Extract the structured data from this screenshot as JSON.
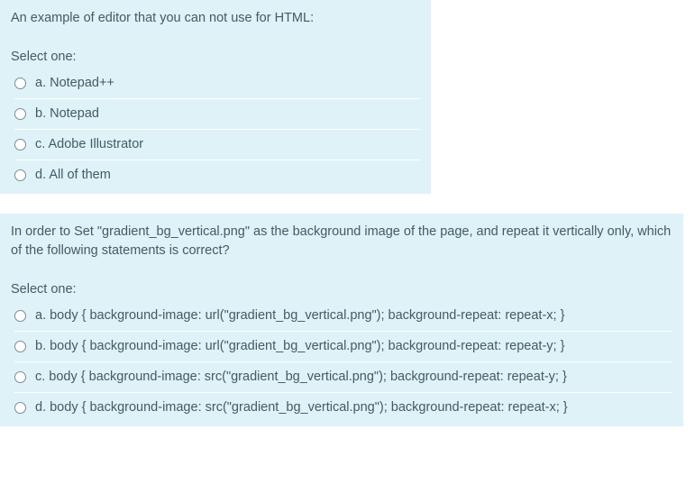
{
  "q1": {
    "text": "An example of editor that you can not use for HTML:",
    "select_one": "Select one:",
    "options": [
      {
        "label": "a. Notepad++"
      },
      {
        "label": "b. Notepad"
      },
      {
        "label": "c. Adobe Illustrator"
      },
      {
        "label": "d. All of them"
      }
    ]
  },
  "q2": {
    "text": "In order to Set \"gradient_bg_vertical.png\" as the background image of the page, and repeat it vertically only, which of the following statements is correct?",
    "select_one": "Select one:",
    "options": [
      {
        "label": "a. body { background-image: url(\"gradient_bg_vertical.png\"); background-repeat: repeat-x; }"
      },
      {
        "label": "b. body { background-image: url(\"gradient_bg_vertical.png\"); background-repeat: repeat-y; }"
      },
      {
        "label": "c. body { background-image: src(\"gradient_bg_vertical.png\"); background-repeat: repeat-y; }"
      },
      {
        "label": "d. body { background-image: src(\"gradient_bg_vertical.png\"); background-repeat: repeat-x; }"
      }
    ]
  }
}
